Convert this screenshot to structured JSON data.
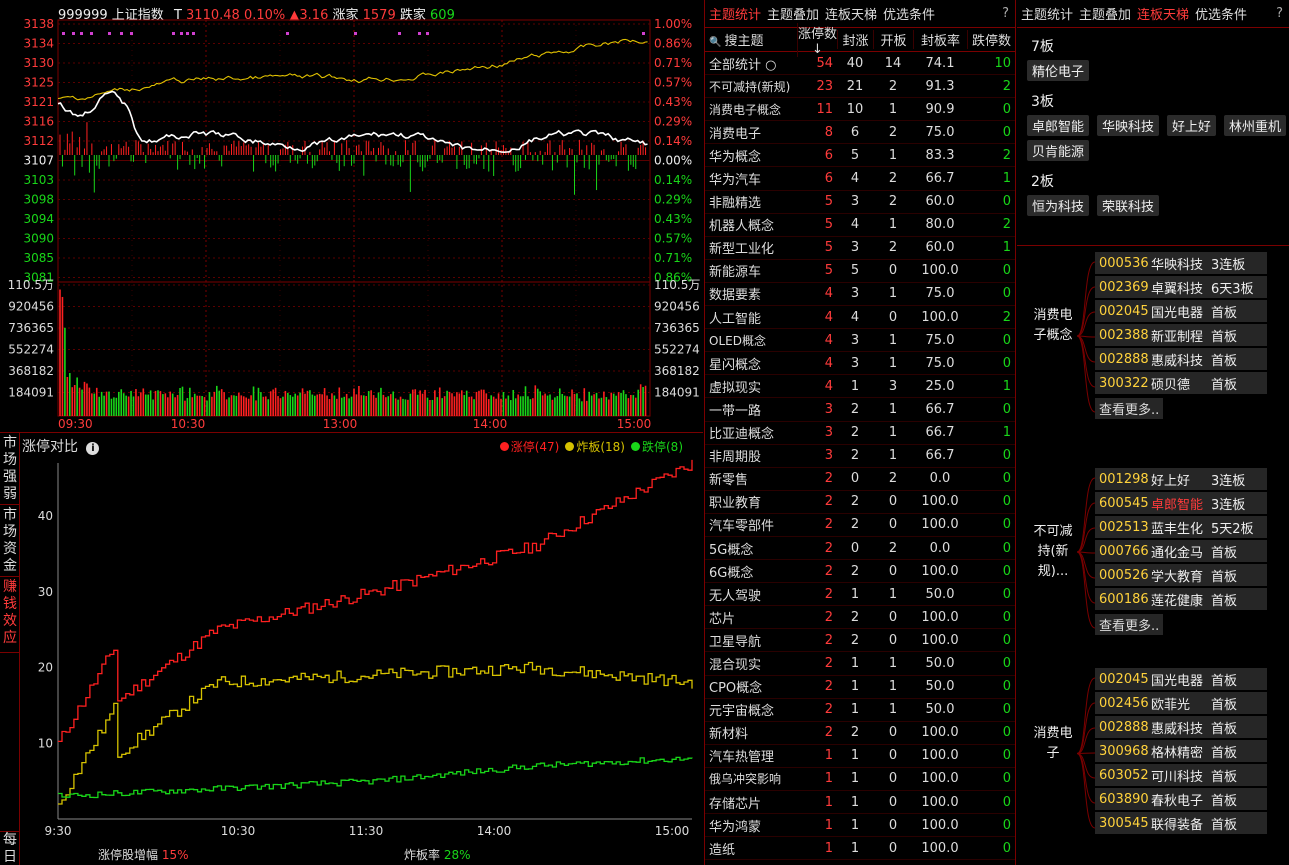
{
  "index_header": {
    "code": "999999",
    "name": "上证指数",
    "t_label": "T",
    "price": "3110.48",
    "pct": "0.10%",
    "chg": "▲3.16",
    "up_label": "涨家",
    "up_count": "1579",
    "down_label": "跌家",
    "down_count": "609"
  },
  "price_axis_left": [
    "3138",
    "3134",
    "3130",
    "3125",
    "3121",
    "3116",
    "3112",
    "3107",
    "3103",
    "3098",
    "3094",
    "3090",
    "3085",
    "3081"
  ],
  "price_axis_right": [
    "1.00%",
    "0.86%",
    "0.71%",
    "0.57%",
    "0.43%",
    "0.29%",
    "0.14%",
    "0.00%",
    "0.14%",
    "0.29%",
    "0.43%",
    "0.57%",
    "0.71%",
    "0.86%"
  ],
  "volume_axis": [
    "110.5万",
    "920456",
    "736365",
    "552274",
    "368182",
    "184091"
  ],
  "volume_axis_right": [
    "110.5万",
    "920456",
    "736365",
    "552274",
    "368182",
    "184091"
  ],
  "time_axis_top": [
    "09:30",
    "10:30",
    "13:00",
    "14:00",
    "15:00"
  ],
  "left_side_buttons": [
    "市场强弱",
    "市场资金",
    "赚钱效应"
  ],
  "bottom_side_button": "每日",
  "compare_panel": {
    "title": "涨停对比",
    "info_icon": "info-icon",
    "legend": [
      {
        "label": "涨停(47)",
        "color": "#ff2020"
      },
      {
        "label": "炸板(18)",
        "color": "#d6c200"
      },
      {
        "label": "跌停(8)",
        "color": "#19d619"
      }
    ],
    "y_ticks": [
      "40",
      "30",
      "20",
      "10"
    ],
    "x_ticks": [
      "9:30",
      "10:30",
      "11:30",
      "14:00",
      "15:00"
    ],
    "footer_left_label": "涨停股增幅",
    "footer_left_value": "15%",
    "footer_right_label": "炸板率",
    "footer_right_value": "28%"
  },
  "chart_data": {
    "type": "line",
    "x": [
      "9:30",
      "10:30",
      "11:30",
      "14:00",
      "15:00"
    ],
    "series": [
      {
        "name": "涨停(47)",
        "color": "#ff2020",
        "values": [
          10,
          25,
          30,
          36,
          47
        ]
      },
      {
        "name": "炸板(18)",
        "color": "#d6c200",
        "values": [
          3,
          18,
          19,
          20,
          18
        ]
      },
      {
        "name": "跌停(8)",
        "color": "#19d619",
        "values": [
          3,
          4,
          5,
          7,
          8
        ]
      }
    ],
    "ylim": [
      0,
      47
    ]
  },
  "mid": {
    "tabs": [
      "主题统计",
      "主题叠加",
      "连板天梯",
      "优选条件"
    ],
    "active_tab": 0,
    "help": "?",
    "headers": [
      "搜主题",
      "涨停数↓",
      "封涨",
      "开板",
      "封板率",
      "跌停数"
    ],
    "rows": [
      [
        "全部统计",
        "54",
        "40",
        "14",
        "74.1",
        "10"
      ],
      [
        "不可减持(新规)",
        "23",
        "21",
        "2",
        "91.3",
        "2"
      ],
      [
        "消费电子概念",
        "11",
        "10",
        "1",
        "90.9",
        "0"
      ],
      [
        "消费电子",
        "8",
        "6",
        "2",
        "75.0",
        "0"
      ],
      [
        "华为概念",
        "6",
        "5",
        "1",
        "83.3",
        "2"
      ],
      [
        "华为汽车",
        "6",
        "4",
        "2",
        "66.7",
        "1"
      ],
      [
        "非融精选",
        "5",
        "3",
        "2",
        "60.0",
        "0"
      ],
      [
        "机器人概念",
        "5",
        "4",
        "1",
        "80.0",
        "2"
      ],
      [
        "新型工业化",
        "5",
        "3",
        "2",
        "60.0",
        "1"
      ],
      [
        "新能源车",
        "5",
        "5",
        "0",
        "100.0",
        "0"
      ],
      [
        "数据要素",
        "4",
        "3",
        "1",
        "75.0",
        "0"
      ],
      [
        "人工智能",
        "4",
        "4",
        "0",
        "100.0",
        "2"
      ],
      [
        "OLED概念",
        "4",
        "3",
        "1",
        "75.0",
        "0"
      ],
      [
        "星闪概念",
        "4",
        "3",
        "1",
        "75.0",
        "0"
      ],
      [
        "虚拟现实",
        "4",
        "1",
        "3",
        "25.0",
        "1"
      ],
      [
        "一带一路",
        "3",
        "2",
        "1",
        "66.7",
        "0"
      ],
      [
        "比亚迪概念",
        "3",
        "2",
        "1",
        "66.7",
        "1"
      ],
      [
        "非周期股",
        "3",
        "2",
        "1",
        "66.7",
        "0"
      ],
      [
        "新零售",
        "2",
        "0",
        "2",
        "0.0",
        "0"
      ],
      [
        "职业教育",
        "2",
        "2",
        "0",
        "100.0",
        "0"
      ],
      [
        "汽车零部件",
        "2",
        "2",
        "0",
        "100.0",
        "0"
      ],
      [
        "5G概念",
        "2",
        "0",
        "2",
        "0.0",
        "0"
      ],
      [
        "6G概念",
        "2",
        "2",
        "0",
        "100.0",
        "0"
      ],
      [
        "无人驾驶",
        "2",
        "1",
        "1",
        "50.0",
        "0"
      ],
      [
        "芯片",
        "2",
        "2",
        "0",
        "100.0",
        "0"
      ],
      [
        "卫星导航",
        "2",
        "2",
        "0",
        "100.0",
        "0"
      ],
      [
        "混合现实",
        "2",
        "1",
        "1",
        "50.0",
        "0"
      ],
      [
        "CPO概念",
        "2",
        "1",
        "1",
        "50.0",
        "0"
      ],
      [
        "元宇宙概念",
        "2",
        "1",
        "1",
        "50.0",
        "0"
      ],
      [
        "新材料",
        "2",
        "2",
        "0",
        "100.0",
        "0"
      ],
      [
        "汽车热管理",
        "1",
        "1",
        "0",
        "100.0",
        "0"
      ],
      [
        "俄乌冲突影响",
        "1",
        "1",
        "0",
        "100.0",
        "0"
      ],
      [
        "存储芯片",
        "1",
        "1",
        "0",
        "100.0",
        "0"
      ],
      [
        "华为鸿蒙",
        "1",
        "1",
        "0",
        "100.0",
        "0"
      ],
      [
        "造纸",
        "1",
        "1",
        "0",
        "100.0",
        "0"
      ]
    ]
  },
  "right": {
    "tabs": [
      "主题统计",
      "主题叠加",
      "连板天梯",
      "优选条件"
    ],
    "active_tab": 2,
    "help": "?",
    "ladder": [
      {
        "label": "7板",
        "stocks": [
          "精伦电子"
        ]
      },
      {
        "label": "3板",
        "stocks": [
          "卓郎智能",
          "华映科技",
          "好上好",
          "林州重机",
          "贝肯能源"
        ]
      },
      {
        "label": "2板",
        "stocks": [
          "恒为科技",
          "荣联科技"
        ]
      }
    ],
    "groups": [
      {
        "title": "消费电子概念",
        "stocks": [
          [
            "000536",
            "华映科技",
            "3连板"
          ],
          [
            "002369",
            "卓翼科技",
            "6天3板"
          ],
          [
            "002045",
            "国光电器",
            "首板"
          ],
          [
            "002388",
            "新亚制程",
            "首板"
          ],
          [
            "002888",
            "惠威科技",
            "首板"
          ],
          [
            "300322",
            "硕贝德",
            "首板"
          ]
        ],
        "more": "查看更多.."
      },
      {
        "title": "不可减持(新规)...",
        "stocks": [
          [
            "001298",
            "好上好",
            "3连板"
          ],
          [
            "600545",
            "卓郎智能",
            "3连板"
          ],
          [
            "002513",
            "蓝丰生化",
            "5天2板"
          ],
          [
            "000766",
            "通化金马",
            "首板"
          ],
          [
            "000526",
            "学大教育",
            "首板"
          ],
          [
            "600186",
            "莲花健康",
            "首板"
          ]
        ],
        "more": "查看更多.."
      },
      {
        "title": "消费电子",
        "stocks": [
          [
            "002045",
            "国光电器",
            "首板"
          ],
          [
            "002456",
            "欧菲光",
            "首板"
          ],
          [
            "002888",
            "惠威科技",
            "首板"
          ],
          [
            "300968",
            "格林精密",
            "首板"
          ],
          [
            "603052",
            "可川科技",
            "首板"
          ],
          [
            "603890",
            "春秋电子",
            "首板"
          ],
          [
            "300545",
            "联得装备",
            "首板"
          ]
        ],
        "more": ""
      }
    ]
  }
}
